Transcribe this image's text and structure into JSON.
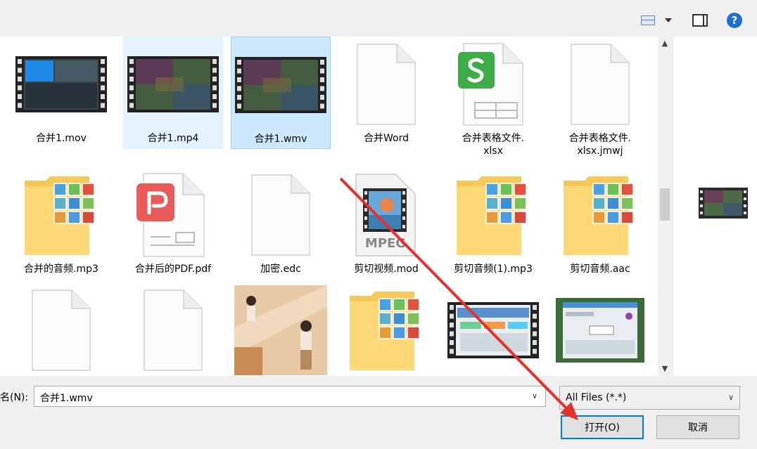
{
  "toolbar": {
    "icons": [
      "change-view-icon",
      "more-options-icon",
      "preview-pane-icon",
      "help-icon"
    ],
    "help_glyph": "?"
  },
  "files": [
    {
      "name": "合并1.mov",
      "kind": "video",
      "state": "normal"
    },
    {
      "name": "合并1.mp4",
      "kind": "video",
      "state": "hover"
    },
    {
      "name": "合并1.wmv",
      "kind": "video",
      "state": "selected"
    },
    {
      "name": "合并Word",
      "kind": "blank-document",
      "state": "normal"
    },
    {
      "name": "合并表格文件.\nxlsx",
      "kind": "spreadsheet",
      "state": "normal"
    },
    {
      "name": "合并表格文件.\nxlsx.jmwj",
      "kind": "blank-document",
      "state": "normal"
    },
    {
      "name": "合并的音频.mp3",
      "kind": "media-folder",
      "state": "normal"
    },
    {
      "name": "合并后的PDF.pdf",
      "kind": "pdf",
      "state": "normal"
    },
    {
      "name": "加密.edc",
      "kind": "blank-document",
      "state": "normal"
    },
    {
      "name": "剪切视频.mod",
      "kind": "mpeg",
      "state": "normal"
    },
    {
      "name": "剪切音频(1).mp3",
      "kind": "media-folder",
      "state": "normal"
    },
    {
      "name": "剪切音频.aac",
      "kind": "media-folder",
      "state": "normal"
    },
    {
      "name": "",
      "kind": "blank-document",
      "state": "normal"
    },
    {
      "name": "",
      "kind": "blank-document",
      "state": "normal"
    },
    {
      "name": "",
      "kind": "photo",
      "state": "normal"
    },
    {
      "name": "",
      "kind": "media-folder",
      "state": "normal"
    },
    {
      "name": "",
      "kind": "video",
      "state": "normal"
    },
    {
      "name": "",
      "kind": "screenshot",
      "state": "normal"
    }
  ],
  "mpeg_text": "MPEG",
  "bottom": {
    "filename_label": "名(N):",
    "filename_value": "合并1.wmv",
    "filter_value": "All Files (*.*)",
    "open_label": "打开(O)",
    "cancel_label": "取消"
  },
  "colors": {
    "selection": "#cce8ff",
    "hover": "#e5f3ff",
    "accent_blue": "#0078d7",
    "annotation_red": "#e8302a",
    "spreadsheet_green": "#3dab47",
    "pdf_red": "#e95b5b",
    "folder_yellow": "#ffd976"
  }
}
